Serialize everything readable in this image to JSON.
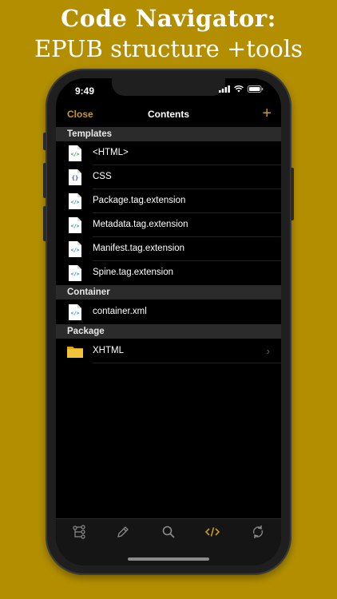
{
  "banner": {
    "line1": "Code Navigator:",
    "line2": "EPUB structure +tools"
  },
  "status_bar": {
    "time": "9:49"
  },
  "nav": {
    "close_label": "Close",
    "title": "Contents",
    "add_label": "+"
  },
  "sections": {
    "templates": {
      "header": "Templates",
      "items": [
        {
          "label": "<HTML>",
          "icon": "html-file-icon"
        },
        {
          "label": "CSS",
          "icon": "css-file-icon"
        },
        {
          "label": "Package.tag.extension",
          "icon": "code-file-icon"
        },
        {
          "label": "Metadata.tag.extension",
          "icon": "code-file-icon"
        },
        {
          "label": "Manifest.tag.extension",
          "icon": "code-file-icon"
        },
        {
          "label": "Spine.tag.extension",
          "icon": "code-file-icon"
        }
      ]
    },
    "container": {
      "header": "Container",
      "items": [
        {
          "label": "container.xml",
          "icon": "code-file-icon"
        }
      ]
    },
    "package": {
      "header": "Package",
      "items": [
        {
          "label": "XHTML",
          "icon": "folder-icon"
        }
      ]
    }
  },
  "tabbar": {
    "tabs": [
      {
        "icon": "structure-tree-icon",
        "selected": false
      },
      {
        "icon": "pencil-icon",
        "selected": false
      },
      {
        "icon": "search-icon",
        "selected": false
      },
      {
        "icon": "code-brackets-icon",
        "selected": true
      },
      {
        "icon": "sync-icon",
        "selected": false
      }
    ]
  },
  "colors": {
    "background": "#b38f00",
    "accent": "#c99a1c",
    "screen": "#000000"
  }
}
